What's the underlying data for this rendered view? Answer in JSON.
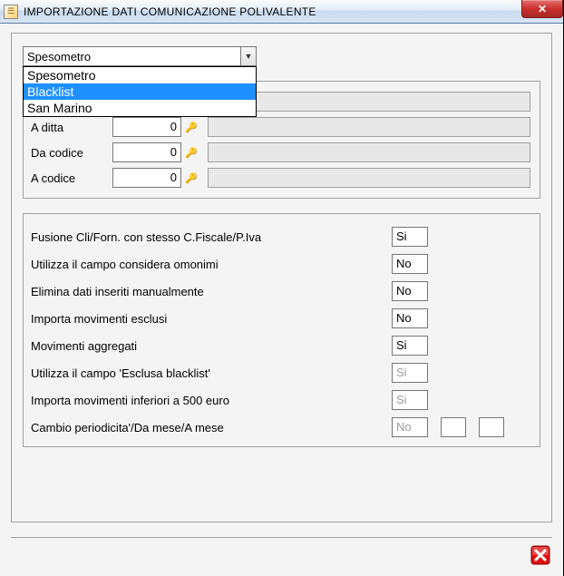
{
  "window": {
    "title": "IMPORTAZIONE DATI COMUNICAZIONE POLIVALENTE"
  },
  "combo": {
    "selected": "Spesometro",
    "options": [
      "Spesometro",
      "Blacklist",
      "San Marino"
    ],
    "highlight_index": 1
  },
  "upper": {
    "rows": [
      {
        "label": "",
        "value": ""
      },
      {
        "label": "A ditta",
        "value": "0"
      },
      {
        "label": "Da codice",
        "value": "0"
      },
      {
        "label": "A codice",
        "value": "0"
      }
    ]
  },
  "lower": {
    "rows": [
      {
        "label": "Fusione Cli/Forn. con stesso C.Fiscale/P.Iva",
        "value": "Si",
        "disabled": false
      },
      {
        "label": "Utilizza il campo considera omonimi",
        "value": "No",
        "disabled": false
      },
      {
        "label": "Elimina dati inseriti manualmente",
        "value": "No",
        "disabled": false
      },
      {
        "label": "Importa movimenti esclusi",
        "value": "No",
        "disabled": false
      },
      {
        "label": "Movimenti aggregati",
        "value": "Si",
        "disabled": false
      },
      {
        "label": "Utilizza il campo 'Esclusa blacklist'",
        "value": "Si",
        "disabled": true
      },
      {
        "label": "Importa movimenti inferiori a 500 euro",
        "value": "Si",
        "disabled": true
      },
      {
        "label": "Cambio periodicita'/Da mese/A mese",
        "value": "No",
        "disabled": true,
        "extra_boxes": 2
      }
    ]
  }
}
